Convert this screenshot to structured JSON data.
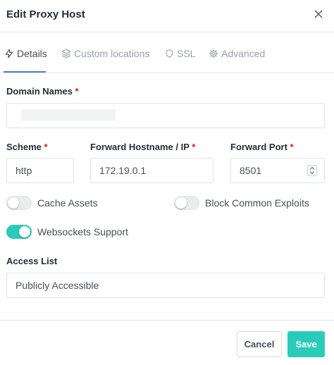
{
  "header": {
    "title": "Edit Proxy Host"
  },
  "tabs": [
    {
      "label": "Details",
      "icon": "zap-icon",
      "active": true
    },
    {
      "label": "Custom locations",
      "icon": "layers-icon",
      "active": false
    },
    {
      "label": "SSL",
      "icon": "shield-icon",
      "active": false
    },
    {
      "label": "Advanced",
      "icon": "gear-icon",
      "active": false
    }
  ],
  "form": {
    "domain_names": {
      "label": "Domain Names",
      "required_mark": "*",
      "value": ""
    },
    "scheme": {
      "label": "Scheme",
      "required_mark": "*",
      "value": "http"
    },
    "forward_host": {
      "label": "Forward Hostname / IP",
      "required_mark": "*",
      "value": "172.19.0.1"
    },
    "forward_port": {
      "label": "Forward Port",
      "required_mark": "*",
      "value": "8501"
    },
    "toggles": {
      "cache_assets": {
        "label": "Cache Assets",
        "enabled": false
      },
      "block_exploits": {
        "label": "Block Common Exploits",
        "enabled": false
      },
      "websockets": {
        "label": "Websockets Support",
        "enabled": true
      }
    },
    "access_list": {
      "label": "Access List",
      "value": "Publicly Accessible"
    }
  },
  "footer": {
    "cancel_label": "Cancel",
    "save_label": "Save"
  },
  "colors": {
    "accent_teal": "#2bcbba",
    "tab_active_underline": "#467fcf",
    "required": "#cd201f"
  }
}
